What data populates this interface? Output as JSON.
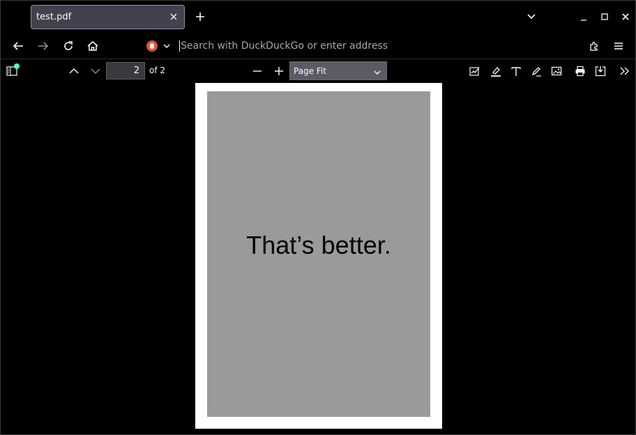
{
  "tab": {
    "title": "test.pdf"
  },
  "urlbar": {
    "placeholder": "Search with DuckDuckGo or enter address",
    "engine_icon": "duckduckgo-icon"
  },
  "pdf_toolbar": {
    "page_number": "2",
    "page_count_label": "of 2",
    "zoom_value": "Page Fit"
  },
  "document": {
    "text": "That’s better."
  },
  "colors": {
    "background": "#000000",
    "tab_bg": "#42414d",
    "select_bg": "#5b5b66",
    "page_bg": "#ffffff",
    "content_bg": "#9a9a9a",
    "notification_dot": "#54ffbd"
  }
}
